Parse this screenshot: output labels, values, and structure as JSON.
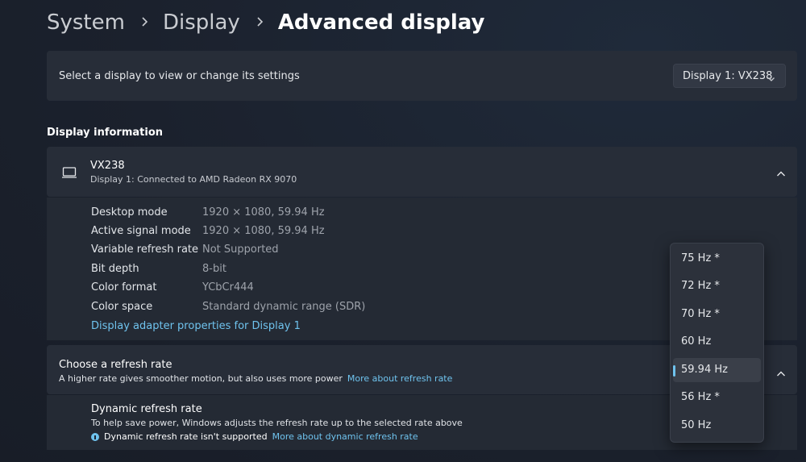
{
  "breadcrumb": {
    "items": [
      "System",
      "Display",
      "Advanced display"
    ]
  },
  "select_display": {
    "label": "Select a display to view or change its settings",
    "dropdown_value": "Display 1: VX238"
  },
  "display_information": {
    "section_title": "Display information",
    "monitor_name": "VX238",
    "monitor_subtitle": "Display 1: Connected to AMD Radeon RX 9070",
    "rows": [
      {
        "label": "Desktop mode",
        "value": "1920 × 1080, 59.94 Hz"
      },
      {
        "label": "Active signal mode",
        "value": "1920 × 1080, 59.94 Hz"
      },
      {
        "label": "Variable refresh rate",
        "value": "Not Supported"
      },
      {
        "label": "Bit depth",
        "value": "8-bit"
      },
      {
        "label": "Color format",
        "value": "YCbCr444"
      },
      {
        "label": "Color space",
        "value": "Standard dynamic range (SDR)"
      }
    ],
    "adapter_link": "Display adapter properties for Display 1"
  },
  "refresh_rate": {
    "title": "Choose a refresh rate",
    "subtitle": "A higher rate gives smoother motion, but also uses more power",
    "link": "More about refresh rate",
    "options": [
      "75 Hz *",
      "72 Hz *",
      "70 Hz *",
      "60 Hz",
      "59.94 Hz",
      "56 Hz *",
      "50 Hz"
    ],
    "selected": "59.94 Hz"
  },
  "dynamic_refresh": {
    "title": "Dynamic refresh rate",
    "subtitle": "To help save power, Windows adjusts the refresh rate up to the selected rate above",
    "info_text": "Dynamic refresh rate isn't supported",
    "link": "More about dynamic refresh rate"
  },
  "colors": {
    "accent": "#6fc3ee",
    "card": "#272d38",
    "background": "#1c2330"
  }
}
